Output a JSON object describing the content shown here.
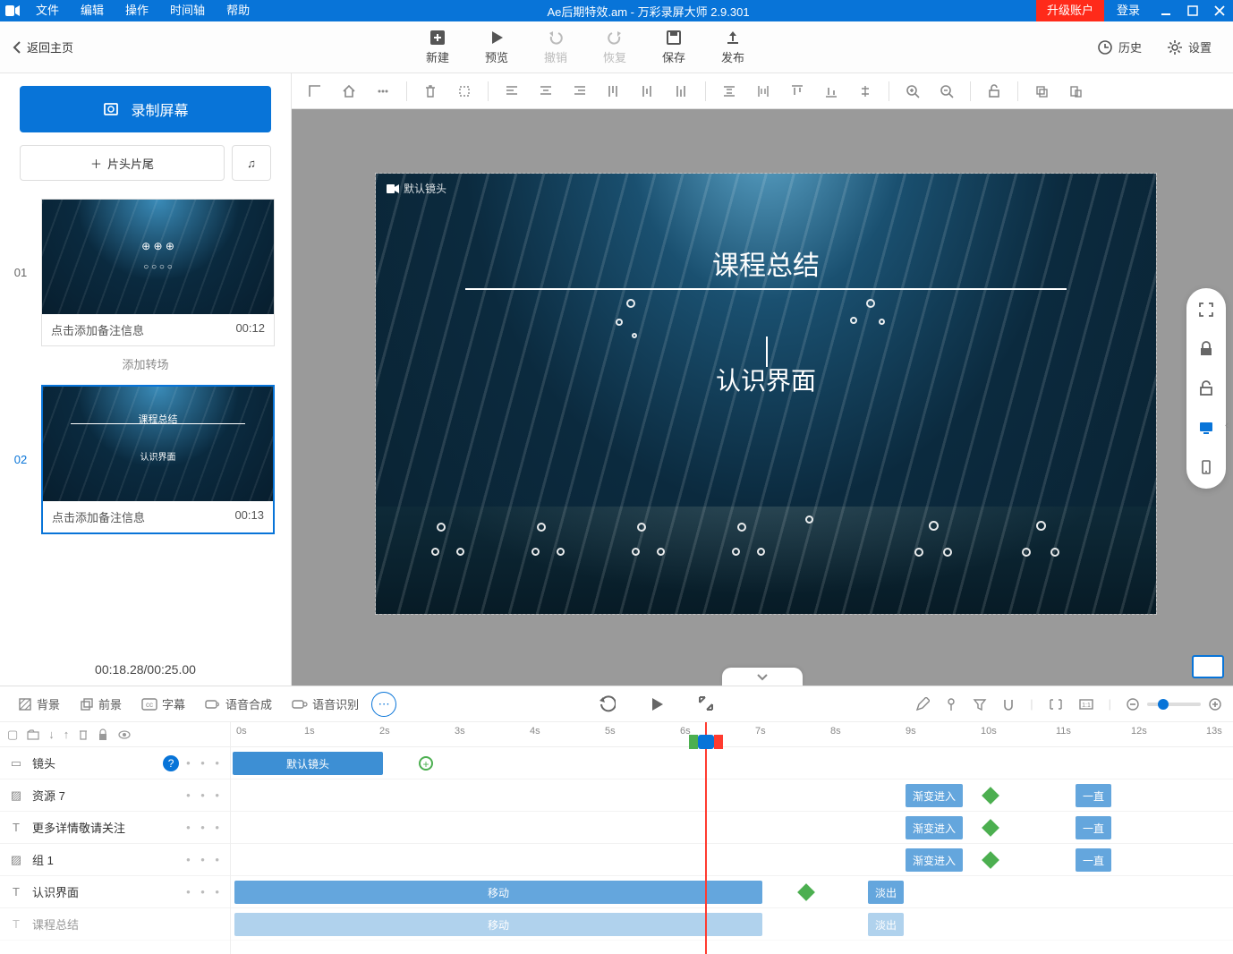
{
  "titlebar": {
    "menus": [
      "文件",
      "编辑",
      "操作",
      "时间轴",
      "帮助"
    ],
    "title": "Ae后期特效.am - 万彩录屏大师 2.9.301",
    "upgrade": "升级账户",
    "login": "登录"
  },
  "main_toolbar": {
    "back": "返回主页",
    "buttons": [
      {
        "label": "新建",
        "icon": "plus-box"
      },
      {
        "label": "预览",
        "icon": "play"
      },
      {
        "label": "撤销",
        "icon": "undo",
        "disabled": true
      },
      {
        "label": "恢复",
        "icon": "redo",
        "disabled": true
      },
      {
        "label": "保存",
        "icon": "save"
      },
      {
        "label": "发布",
        "icon": "publish"
      }
    ],
    "right": [
      {
        "label": "历史",
        "icon": "history"
      },
      {
        "label": "设置",
        "icon": "gear"
      }
    ]
  },
  "left_panel": {
    "record": "录制屏幕",
    "add_clip": "片头片尾",
    "scenes": [
      {
        "num": "01",
        "note": "点击添加备注信息",
        "dur": "00:12",
        "active": false
      },
      {
        "num": "02",
        "note": "点击添加备注信息",
        "dur": "00:13",
        "active": true,
        "thumb_t1": "课程总结",
        "thumb_t2": "认识界面"
      }
    ],
    "add_transition": "添加转场",
    "time": "00:18.28/00:25.00"
  },
  "canvas": {
    "cam_label": "默认镜头",
    "title": "课程总结",
    "subtitle": "认识界面"
  },
  "layer_tabs": [
    {
      "label": "背景",
      "icon": "hatch"
    },
    {
      "label": "前景",
      "icon": "layers"
    },
    {
      "label": "字幕",
      "icon": "cc"
    },
    {
      "label": "语音合成",
      "icon": "speak"
    },
    {
      "label": "语音识别",
      "icon": "recognize"
    }
  ],
  "timeline": {
    "ticks": [
      "0s",
      "1s",
      "2s",
      "3s",
      "4s",
      "5s",
      "6s",
      "7s",
      "8s",
      "9s",
      "10s",
      "11s",
      "12s",
      "13s"
    ],
    "tracks": [
      {
        "icon": "camera",
        "name": "镜头",
        "help": true
      },
      {
        "icon": "image",
        "name": "资源 7"
      },
      {
        "icon": "text",
        "name": "更多详情敬请关注"
      },
      {
        "icon": "image",
        "name": "组 1"
      },
      {
        "icon": "text",
        "name": "认识界面"
      },
      {
        "icon": "text",
        "name": "课程总结"
      }
    ],
    "clips": {
      "camera": "默认镜头",
      "fade_in": "渐变进入",
      "always": "一直",
      "move": "移动",
      "fade_out": "淡出"
    }
  }
}
